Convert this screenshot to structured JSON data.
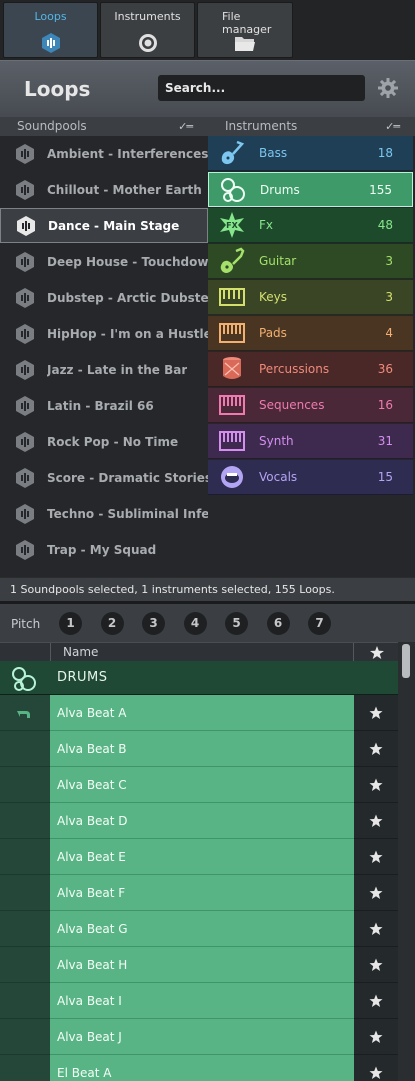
{
  "tabs": [
    {
      "label": "Loops",
      "icon": "loops-icon",
      "active": true
    },
    {
      "label": "Instruments",
      "icon": "instruments-icon",
      "active": false
    },
    {
      "label": "File manager",
      "icon": "folder-icon",
      "active": false
    }
  ],
  "header": {
    "title": "Loops",
    "search_placeholder": "Search...",
    "settings_icon": "gear-icon"
  },
  "columns": {
    "soundpools": "Soundpools",
    "instruments": "Instruments"
  },
  "soundpools": [
    {
      "label": "Ambient - Interferences",
      "selected": false
    },
    {
      "label": "Chillout - Mother Earth",
      "selected": false
    },
    {
      "label": "Dance - Main Stage",
      "selected": true
    },
    {
      "label": "Deep House - Touchdown",
      "selected": false
    },
    {
      "label": "Dubstep - Arctic Dubstep",
      "selected": false
    },
    {
      "label": "HipHop - I'm on a Hustle",
      "selected": false
    },
    {
      "label": "Jazz - Late in the Bar",
      "selected": false
    },
    {
      "label": "Latin - Brazil 66",
      "selected": false
    },
    {
      "label": "Rock Pop - No Time",
      "selected": false
    },
    {
      "label": "Score - Dramatic Stories",
      "selected": false
    },
    {
      "label": "Techno - Subliminal Infern",
      "selected": false
    },
    {
      "label": "Trap - My Squad",
      "selected": false
    }
  ],
  "instruments": [
    {
      "name": "Bass",
      "count": "18",
      "icon": "bass-guitar-icon",
      "bg": "#1e3f55",
      "color": "#7cc6f0",
      "selected": false
    },
    {
      "name": "Drums",
      "count": "155",
      "icon": "drums-icon",
      "bg": "#3f9a6a",
      "color": "#eefff4",
      "selected": true
    },
    {
      "name": "Fx",
      "count": "48",
      "icon": "fx-icon",
      "bg": "#1d4a2b",
      "color": "#86e68c",
      "selected": false
    },
    {
      "name": "Guitar",
      "count": "3",
      "icon": "guitar-icon",
      "bg": "#2d4a24",
      "color": "#a4e06a",
      "selected": false
    },
    {
      "name": "Keys",
      "count": "3",
      "icon": "keys-icon",
      "bg": "#3a4526",
      "color": "#d4e06e",
      "selected": false
    },
    {
      "name": "Pads",
      "count": "4",
      "icon": "pads-icon",
      "bg": "#4a3422",
      "color": "#f2b070",
      "selected": false
    },
    {
      "name": "Percussions",
      "count": "36",
      "icon": "percussion-icon",
      "bg": "#4a2828",
      "color": "#f08a7a",
      "selected": false
    },
    {
      "name": "Sequences",
      "count": "16",
      "icon": "sequences-icon",
      "bg": "#4a2838",
      "color": "#f07ab0",
      "selected": false
    },
    {
      "name": "Synth",
      "count": "31",
      "icon": "synth-icon",
      "bg": "#3d2a4e",
      "color": "#d58ef0",
      "selected": false
    },
    {
      "name": "Vocals",
      "count": "15",
      "icon": "vocals-icon",
      "bg": "#2e2c50",
      "color": "#b4a4f4",
      "selected": false
    }
  ],
  "status": "1 Soundpools selected, 1 instruments selected, 155 Loops.",
  "pitch": {
    "label": "Pitch",
    "buttons": [
      "1",
      "2",
      "3",
      "4",
      "5",
      "6",
      "7"
    ]
  },
  "table": {
    "name_header": "Name",
    "group": "DRUMS"
  },
  "loops": [
    {
      "name": "Alva Beat A",
      "tagged": true
    },
    {
      "name": "Alva Beat B",
      "tagged": false
    },
    {
      "name": "Alva Beat C",
      "tagged": false
    },
    {
      "name": "Alva Beat D",
      "tagged": false
    },
    {
      "name": "Alva Beat E",
      "tagged": false
    },
    {
      "name": "Alva Beat F",
      "tagged": false
    },
    {
      "name": "Alva Beat G",
      "tagged": false
    },
    {
      "name": "Alva Beat H",
      "tagged": false
    },
    {
      "name": "Alva Beat I",
      "tagged": false
    },
    {
      "name": "Alva Beat J",
      "tagged": false
    },
    {
      "name": "El Beat A",
      "tagged": false
    }
  ],
  "colors": {
    "accent": "#54b6e6",
    "selected_green": "#3f9a6a",
    "loop_green": "#59b485"
  }
}
